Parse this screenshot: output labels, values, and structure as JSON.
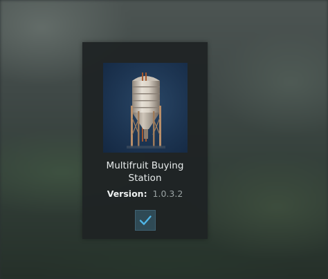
{
  "mod": {
    "title_line1": "Multifruit Buying",
    "title_line2": "Station",
    "version_label": "Version:",
    "version_value": "1.0.3.2",
    "selected": true,
    "thumbnail_icon": "grain-silo-image"
  },
  "colors": {
    "checkmark": "#4fb6e8",
    "checkbox_bg": "#2f4a55",
    "card_bg": "#1e2224"
  }
}
